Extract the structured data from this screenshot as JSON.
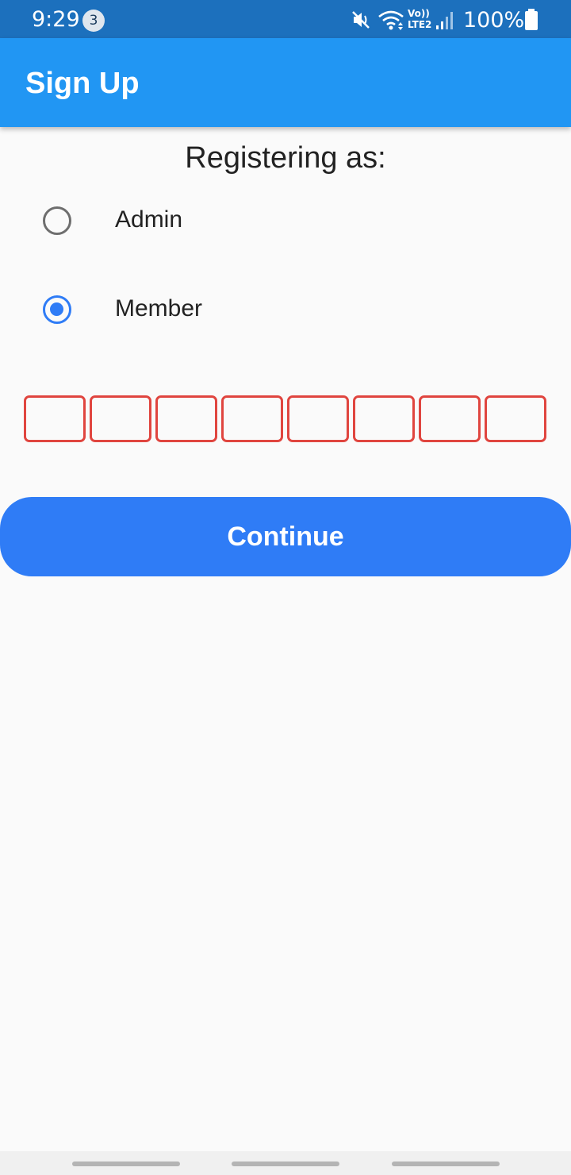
{
  "status_bar": {
    "time": "9:29",
    "notification_count": "3",
    "network_label": "Vo))\nLTE2",
    "battery_percent": "100%",
    "icons": [
      "mute-icon",
      "wifi-icon",
      "volte-icon",
      "signal-icon",
      "battery-icon"
    ]
  },
  "app_bar": {
    "title": "Sign Up"
  },
  "form": {
    "heading": "Registering as:",
    "options": [
      {
        "label": "Admin",
        "selected": false
      },
      {
        "label": "Member",
        "selected": true
      }
    ],
    "code_boxes": [
      "",
      "",
      "",
      "",
      "",
      "",
      "",
      ""
    ],
    "continue_label": "Continue"
  },
  "colors": {
    "status_bar": "#1c70bd",
    "app_bar": "#2196f3",
    "accent": "#2f7cf6",
    "error_border": "#e0453f",
    "background": "#fafafa"
  }
}
